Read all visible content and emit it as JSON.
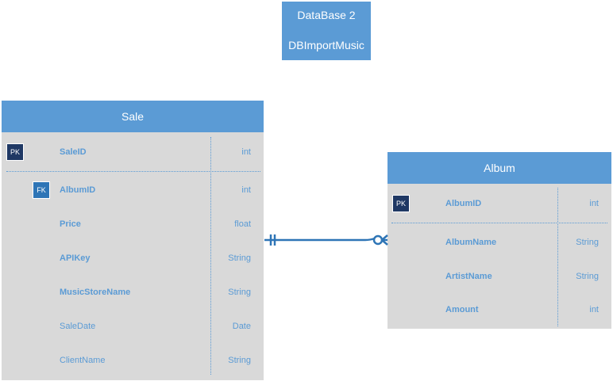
{
  "database": {
    "line1": "DataBase 2",
    "line2": "DBImportMusic"
  },
  "sale": {
    "title": "Sale",
    "pk_field": {
      "key": "PK",
      "name": "SaleID",
      "type": "int"
    },
    "fields": [
      {
        "key": "FK",
        "name": "AlbumID",
        "type": "int",
        "bold": true
      },
      {
        "key": "",
        "name": "Price",
        "type": "float",
        "bold": true
      },
      {
        "key": "",
        "name": "APIKey",
        "type": "String",
        "bold": true
      },
      {
        "key": "",
        "name": "MusicStoreName",
        "type": "String",
        "bold": true
      },
      {
        "key": "",
        "name": "SaleDate",
        "type": "Date",
        "bold": false
      },
      {
        "key": "",
        "name": "ClientName",
        "type": "String",
        "bold": false
      }
    ]
  },
  "album": {
    "title": "Album",
    "pk_field": {
      "key": "PK",
      "name": "AlbumID",
      "type": "int"
    },
    "fields": [
      {
        "key": "",
        "name": "AlbumName",
        "type": "String",
        "bold": true
      },
      {
        "key": "",
        "name": "ArtistName",
        "type": "String",
        "bold": true
      },
      {
        "key": "",
        "name": "Amount",
        "type": "int",
        "bold": true
      }
    ]
  },
  "relationship": {
    "from": "Sale",
    "to": "Album",
    "from_cardinality": "one-and-only-one",
    "to_cardinality": "zero-or-many",
    "color": "#2e75b6"
  },
  "colors": {
    "accent": "#5b9bd5",
    "entity_bg": "#d9d9d9",
    "pk_key": "#1f3864",
    "fk_key": "#2e75b6"
  }
}
